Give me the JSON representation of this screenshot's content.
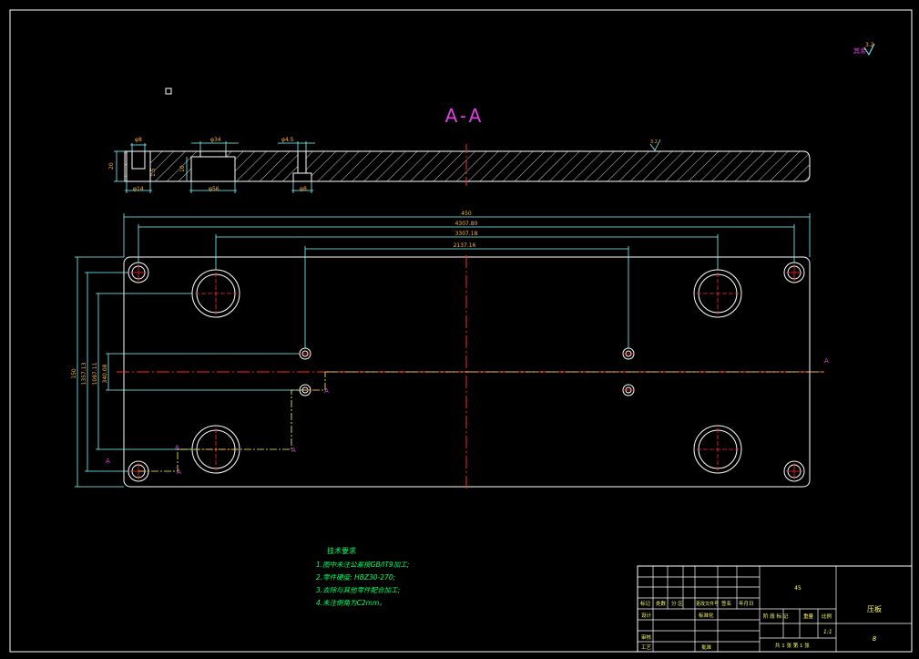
{
  "colors": {
    "background": "#000000",
    "outline": "#ffffff",
    "dimension": "#7fffff",
    "dim_text": "#ffb23a",
    "centerline": "#ff2a2a",
    "section_label": "#e040e0",
    "notes": "#00ff66",
    "yellow": "#ffff66"
  },
  "section_title": "A-A",
  "surface_finish": {
    "main_value": "3.2",
    "prefix": "其余"
  },
  "section_view_dims": {
    "thickness": "20",
    "d_top_left": "φ8",
    "d_bot_left": "φ14",
    "depth_left": "1.5",
    "d_top_mid": "φ34",
    "d_bot_mid": "φ56",
    "depth_mid": "10",
    "d_top_right": "φ4.5",
    "d_bot_right": "φ8",
    "roughness_mark": "3.2"
  },
  "plan_view_dims": {
    "overall_length": "450",
    "len_1": "4307.80",
    "len_2": "3307.18",
    "len_3": "2137.16",
    "overall_height": "150",
    "h_1": "1357.13",
    "h_2": "1087.11",
    "h_3": "340.08",
    "section_letter": "A"
  },
  "tech_notes": {
    "title": "技术要求",
    "items": [
      "1.图中未注公差按GB/IT9加工;",
      "2.零件硬度: HBZ30-270;",
      "3.去除与其他零件配合加工;",
      "4.未注倒角为C2mm。"
    ]
  },
  "title_block": {
    "header_labels": [
      "标记",
      "处数",
      "分 区",
      "更改文件号",
      "签名",
      "年月日"
    ],
    "row_labels": [
      "设计",
      "审核",
      "工艺"
    ],
    "mid_labels": [
      "标准化",
      "批准"
    ],
    "material": "45",
    "stage_labels": [
      "阶 段 标 记",
      "重量",
      "比例"
    ],
    "scale_value": "1:1",
    "sheet_info": "共 1 张  第 1 张",
    "part_name": "压板",
    "drawing_no": "8"
  }
}
